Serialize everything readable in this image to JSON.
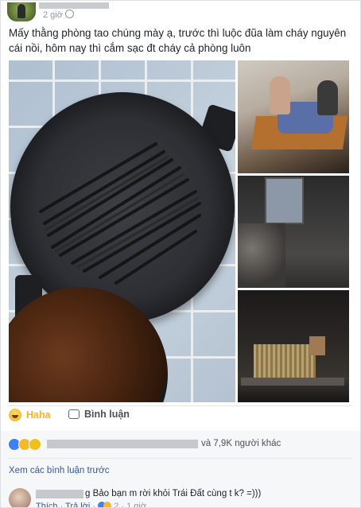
{
  "post": {
    "time": "2 giờ",
    "text": "Mấy thằng phòng tao chúng mày ạ, trước thì luộc đũa làm cháy nguyên cái nồi, hôm nay thì cắm sạc đt cháy cả phòng luôn"
  },
  "actions": {
    "reaction_label": "Haha",
    "comment_label": "Bình luận"
  },
  "reactions": {
    "icons": [
      "like-icon",
      "haha-icon",
      "wow-icon"
    ],
    "others_text": "và 7,9K người khác"
  },
  "comments": {
    "view_previous": "Xem các bình luận trước",
    "items": [
      {
        "text": "g Bảo bạn m rời khỏi Trái Đất cùng t k? =)))",
        "like": "Thích",
        "reply": "Trả lời",
        "reaction_count": "2",
        "time": "1 giờ"
      }
    ]
  },
  "colors": {
    "haha": "#f7b125",
    "link": "#365899",
    "muted": "#90949c"
  }
}
